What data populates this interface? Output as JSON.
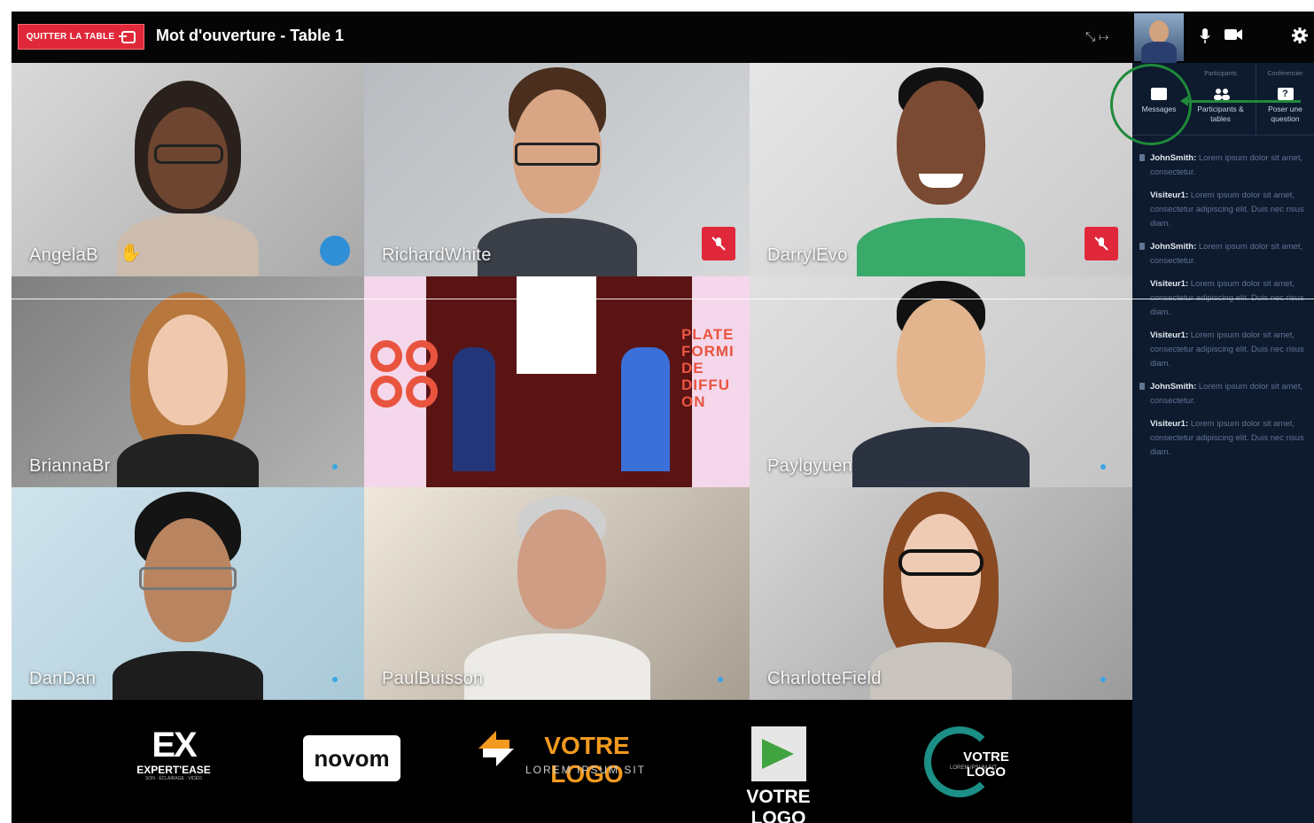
{
  "topbar": {
    "leave_label": "QUITTER LA TABLE",
    "title": "Mot d'ouverture - Table 1",
    "view_icons": "⤡ ↦"
  },
  "tiles": [
    {
      "name": "AngelaB",
      "state": "speaking",
      "raised_hand": true
    },
    {
      "name": "RichardWhite",
      "state": "muted"
    },
    {
      "name": "DarrylEvo",
      "state": "muted"
    },
    {
      "name": "BriannaBr",
      "state": "active"
    },
    {
      "name": "",
      "state": "stage",
      "stage_text": [
        "PLATE",
        "FORMI",
        "DE",
        "DIFFU",
        "ON"
      ]
    },
    {
      "name": "Paylgyuen",
      "state": "active"
    },
    {
      "name": "DanDan",
      "state": "active"
    },
    {
      "name": "PaulBuisson",
      "state": "active"
    },
    {
      "name": "CharlotteField",
      "state": "active"
    }
  ],
  "sponsors": [
    {
      "line1": "EXPERT'EASE",
      "line2": "SON · ÉCLAIRAGE · VIDÉO",
      "mark": "EX"
    },
    {
      "line1": "novom",
      "line2": "",
      "mark": ""
    },
    {
      "line1": "VOTRE LOGO",
      "line2": "LOREM IPSUM SIT",
      "mark": ""
    },
    {
      "line1": "VOTRE LOGO",
      "line2": "",
      "mark": ""
    },
    {
      "line1": "VOTRE LOGO",
      "line2": "LOREM IPSUM SIT",
      "mark": ""
    }
  ],
  "sidebar": {
    "tab_group_participants": "Participants",
    "tab_group_conference": "Conférencier",
    "tabs": [
      {
        "label": "Messages"
      },
      {
        "label": "Participants & tables"
      },
      {
        "label": "Poser une question"
      }
    ],
    "messages": [
      {
        "author": "JohnSmith:",
        "text": "Lorem ipsum dolor sit amet, consectetur.",
        "locked": true
      },
      {
        "author": "Visiteur1:",
        "text": "Lorem ipsum dolor sit amet, consectetur adipiscing elit. Duis nec risus diam.",
        "locked": false
      },
      {
        "author": "JohnSmith:",
        "text": "Lorem ipsum dolor sit amet, consectetur.",
        "locked": true
      },
      {
        "author": "Visiteur1:",
        "text": "Lorem ipsum dolor sit amet, consectetur adipiscing elit. Duis nec risus diam.",
        "locked": false
      },
      {
        "author": "Visiteur1:",
        "text": "Lorem ipsum dolor sit amet, consectetur adipiscing elit. Duis nec risus diam.",
        "locked": false
      },
      {
        "author": "JohnSmith:",
        "text": "Lorem ipsum dolor sit amet, consectetur.",
        "locked": true
      },
      {
        "author": "Visiteur1:",
        "text": "Lorem ipsum dolor sit amet, consectetur adipiscing elit. Duis nec risus diam.",
        "locked": false
      }
    ]
  },
  "colors": {
    "accent_red": "#e0283a",
    "sidebar_bg": "#0e1a2e",
    "highlight_green": "#1f8a3a",
    "active_blue": "#39a6e6"
  }
}
